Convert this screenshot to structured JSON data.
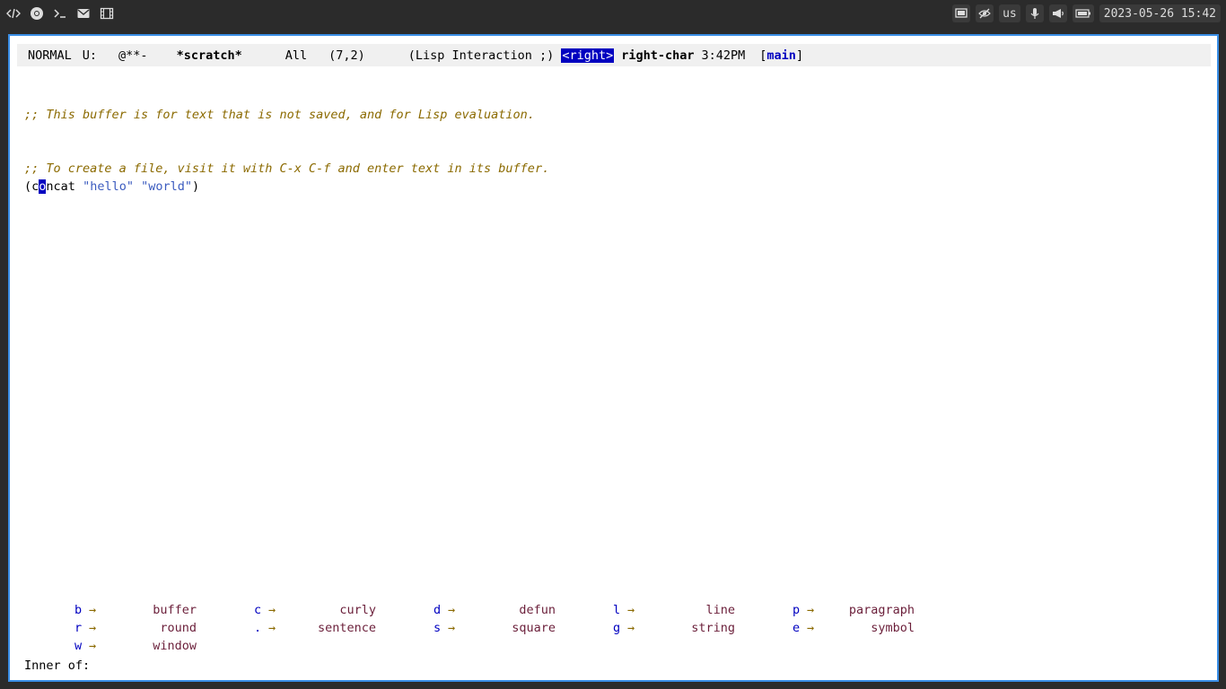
{
  "topbar": {
    "left_icons": [
      "code-icon",
      "chrome-icon",
      "terminal-icon",
      "mail-icon",
      "film-icon"
    ],
    "keyboard_layout": "us",
    "datetime": "2023-05-26 15:42"
  },
  "modeline": {
    "state": "NORMAL",
    "coding": "U:",
    "flags": "@**-",
    "buffer_name": "*scratch*",
    "position": "All",
    "line_col": "(7,2)",
    "major_mode": "(Lisp Interaction ;)",
    "last_key": "<right>",
    "last_command": "right-char",
    "time": "3:42PM",
    "branch_open": "[",
    "branch": "main",
    "branch_close": "]"
  },
  "buffer": {
    "comment1": ";; This buffer is for text that is not saved, and for Lisp evaluation.",
    "comment2": ";; To create a file, visit it with C-x C-f and enter text in its buffer.",
    "code": {
      "open_paren": "(",
      "before_cursor": "c",
      "cursor_char": "o",
      "after_cursor": "ncat ",
      "str1": "\"hello\"",
      "space": " ",
      "str2": "\"world\"",
      "close_paren": ")"
    }
  },
  "which_key": {
    "rows": [
      [
        {
          "key": "b",
          "desc": "buffer"
        },
        {
          "key": "c",
          "desc": "curly"
        },
        {
          "key": "d",
          "desc": "defun"
        },
        {
          "key": "l",
          "desc": "line"
        },
        {
          "key": "p",
          "desc": "paragraph"
        }
      ],
      [
        {
          "key": "r",
          "desc": "round"
        },
        {
          "key": ".",
          "desc": "sentence"
        },
        {
          "key": "s",
          "desc": "square"
        },
        {
          "key": "g",
          "desc": "string"
        },
        {
          "key": "e",
          "desc": "symbol"
        }
      ],
      [
        {
          "key": "w",
          "desc": "window"
        }
      ]
    ],
    "arrow": "→"
  },
  "minibuffer": {
    "prompt": "Inner of:"
  }
}
